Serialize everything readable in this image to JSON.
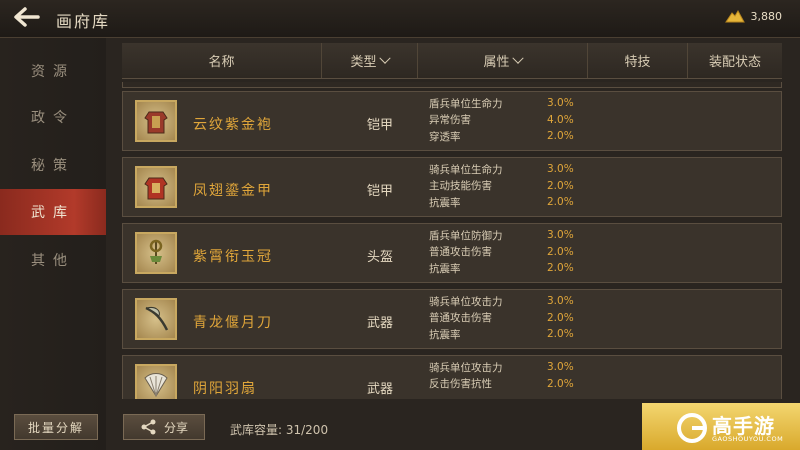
{
  "header": {
    "title": "画府库",
    "currency_value": "3,880"
  },
  "sidebar": {
    "items": [
      {
        "label": "资源"
      },
      {
        "label": "政令"
      },
      {
        "label": "秘策"
      },
      {
        "label": "武库"
      },
      {
        "label": "其他"
      }
    ],
    "active_index": 3,
    "batch_label": "批量分解"
  },
  "table": {
    "columns": {
      "name": "名称",
      "type": "类型",
      "attr": "属性",
      "skill": "特技",
      "status": "装配状态"
    },
    "rows": [
      {
        "icon": "armor-icon",
        "name": "云纹紫金袍",
        "type": "铠甲",
        "attrs": [
          {
            "name": "盾兵单位生命力",
            "value": "3.0%"
          },
          {
            "name": "异常伤害",
            "value": "4.0%"
          },
          {
            "name": "穿透率",
            "value": "2.0%"
          }
        ]
      },
      {
        "icon": "armor-icon",
        "name": "凤翅鎏金甲",
        "type": "铠甲",
        "attrs": [
          {
            "name": "骑兵单位生命力",
            "value": "3.0%"
          },
          {
            "name": "主动技能伤害",
            "value": "2.0%"
          },
          {
            "name": "抗震率",
            "value": "2.0%"
          }
        ]
      },
      {
        "icon": "crown-icon",
        "name": "紫霄衔玉冠",
        "type": "头盔",
        "attrs": [
          {
            "name": "盾兵单位防御力",
            "value": "3.0%"
          },
          {
            "name": "普通攻击伤害",
            "value": "2.0%"
          },
          {
            "name": "抗震率",
            "value": "2.0%"
          }
        ]
      },
      {
        "icon": "blade-icon",
        "name": "青龙偃月刀",
        "type": "武器",
        "attrs": [
          {
            "name": "骑兵单位攻击力",
            "value": "3.0%"
          },
          {
            "name": "普通攻击伤害",
            "value": "2.0%"
          },
          {
            "name": "抗震率",
            "value": "2.0%"
          }
        ]
      },
      {
        "icon": "fan-icon",
        "name": "阴阳羽扇",
        "type": "武器",
        "attrs": [
          {
            "name": "骑兵单位攻击力",
            "value": "3.0%"
          },
          {
            "name": "反击伤害抗性",
            "value": "2.0%"
          }
        ]
      }
    ]
  },
  "footer": {
    "share_label": "分享",
    "capacity_label": "武库容量: 31/200"
  },
  "watermark": {
    "text": "高手游",
    "sub": "GAOSHOUYOU.COM"
  },
  "colors": {
    "accent_gold": "#e0a63a",
    "active_tab_red": "#b23a2a"
  }
}
